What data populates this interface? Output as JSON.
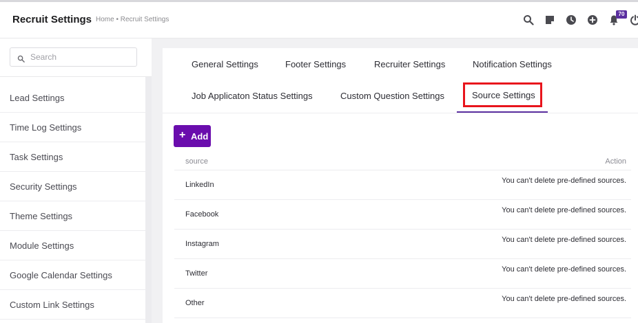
{
  "header": {
    "title": "Recruit Settings",
    "breadcrumb": "Home • Recruit Settings",
    "notification_count": "70",
    "icons": [
      "search-icon",
      "sticky-note-icon",
      "clock-icon",
      "add-circle-icon",
      "bell-icon",
      "power-icon"
    ]
  },
  "sidebar": {
    "search_placeholder": "Search",
    "items": [
      {
        "label": "Lead Settings"
      },
      {
        "label": "Time Log Settings"
      },
      {
        "label": "Task Settings"
      },
      {
        "label": "Security Settings"
      },
      {
        "label": "Theme Settings"
      },
      {
        "label": "Module Settings"
      },
      {
        "label": "Google Calendar Settings"
      },
      {
        "label": "Custom Link Settings"
      }
    ]
  },
  "tabs": {
    "general": "General Settings",
    "footer": "Footer Settings",
    "recruiter": "Recruiter Settings",
    "notification": "Notification Settings",
    "job_status": "Job Applicaton Status Settings",
    "custom_question": "Custom Question Settings",
    "source": "Source Settings",
    "active": "Source Settings"
  },
  "actions": {
    "add_label": "Add"
  },
  "table": {
    "headers": {
      "source": "source",
      "action": "Action"
    },
    "rows": [
      {
        "source": "LinkedIn",
        "action": "You can't delete pre-defined sources."
      },
      {
        "source": "Facebook",
        "action": "You can't delete pre-defined sources."
      },
      {
        "source": "Instagram",
        "action": "You can't delete pre-defined sources."
      },
      {
        "source": "Twitter",
        "action": "You can't delete pre-defined sources."
      },
      {
        "source": "Other",
        "action": "You can't delete pre-defined sources."
      }
    ]
  },
  "colors": {
    "accent": "#6a0dad",
    "tab_underline": "#5b2fa0",
    "highlight_box": "#e8141c",
    "badge": "#5b2fa0"
  }
}
